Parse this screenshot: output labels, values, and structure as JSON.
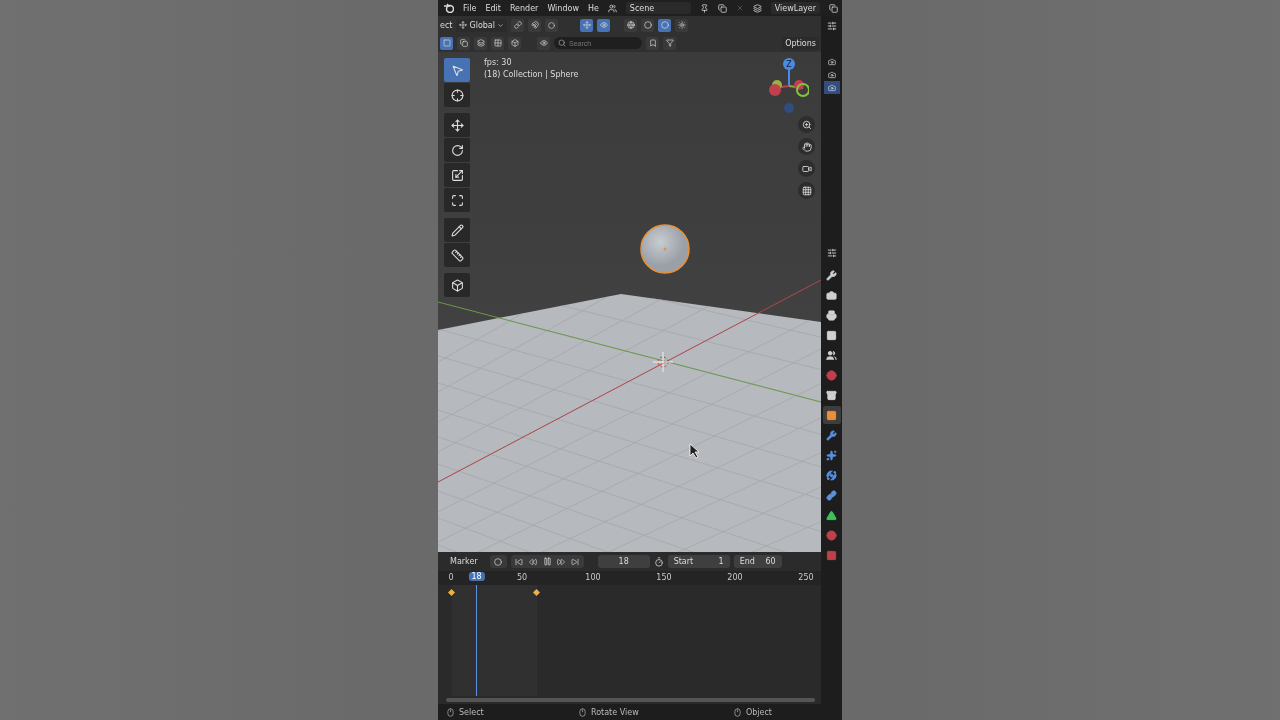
{
  "menu_bar": {
    "items": [
      "File",
      "Edit",
      "Render",
      "Window",
      "He"
    ],
    "scene": "Scene",
    "view_layer": "ViewLayer"
  },
  "header": {
    "mode_label": "ect",
    "orientation": "Global",
    "view_toggles": [
      {
        "kind": "gizmo",
        "on": true
      },
      {
        "kind": "overlay",
        "on": true
      }
    ],
    "shading_modes": [
      {
        "kind": "wireframe",
        "selected": false
      },
      {
        "kind": "solid",
        "selected": false
      },
      {
        "kind": "material",
        "selected": true
      },
      {
        "kind": "rendered",
        "selected": false
      }
    ],
    "select_modes": [
      {
        "kind": "new",
        "selected": true
      },
      {
        "kind": "extend",
        "selected": false
      },
      {
        "kind": "subtract",
        "selected": false
      },
      {
        "kind": "invert",
        "selected": false
      },
      {
        "kind": "intersect",
        "selected": false
      }
    ],
    "search": {
      "placeholder": "Search"
    },
    "options": "Options"
  },
  "toolbar": {
    "groups": [
      [
        {
          "kind": "select",
          "selected": true
        },
        {
          "kind": "cursor",
          "selected": false
        }
      ],
      [
        {
          "kind": "move",
          "selected": false
        },
        {
          "kind": "rotate",
          "selected": false
        },
        {
          "kind": "scale",
          "selected": false
        },
        {
          "kind": "transform",
          "selected": false
        }
      ],
      [
        {
          "kind": "annotate",
          "selected": false
        },
        {
          "kind": "measure",
          "selected": false
        }
      ],
      [
        {
          "kind": "add-cube",
          "selected": false
        }
      ]
    ]
  },
  "overlay": {
    "fps": "fps: 30",
    "info": "(18) Collection | Sphere"
  },
  "gizmo": {
    "z_label": "Z"
  },
  "outliner": {
    "items": [
      {
        "selected": false
      },
      {
        "selected": false
      },
      {
        "selected": true
      }
    ]
  },
  "properties_tabs": [
    {
      "kind": "tool",
      "selected": false,
      "color": "#d0d0d0"
    },
    {
      "kind": "render",
      "selected": false,
      "color": "#d0d0d0"
    },
    {
      "kind": "output",
      "selected": false,
      "color": "#d0d0d0"
    },
    {
      "kind": "view-layer",
      "selected": false,
      "color": "#d0d0d0"
    },
    {
      "kind": "scene",
      "selected": false,
      "color": "#d0d0d0"
    },
    {
      "kind": "world",
      "selected": false,
      "color": "#c0404a"
    },
    {
      "kind": "collection",
      "selected": false,
      "color": "#d0d0d0"
    },
    {
      "kind": "object",
      "selected": true,
      "color": "#e8903a"
    },
    {
      "kind": "modifier",
      "selected": false,
      "color": "#5a8fe0"
    },
    {
      "kind": "particles",
      "selected": false,
      "color": "#5a8fe0"
    },
    {
      "kind": "physics",
      "selected": false,
      "color": "#5a8fe0"
    },
    {
      "kind": "constraint",
      "selected": false,
      "color": "#5a8fe0"
    },
    {
      "kind": "data",
      "selected": false,
      "color": "#3fbf5a"
    },
    {
      "kind": "material",
      "selected": false,
      "color": "#c0404a"
    },
    {
      "kind": "texture",
      "selected": false,
      "color": "#c0404a"
    }
  ],
  "timeline": {
    "marker": "Marker",
    "current_frame": "18",
    "start_label": "Start",
    "start": "1",
    "end_label": "End",
    "end": "60",
    "ruler": [
      "0",
      "50",
      "100",
      "150",
      "200",
      "250"
    ],
    "playhead": "18",
    "playing": true
  },
  "status_bar": [
    "Select",
    "Rotate View",
    "Object"
  ]
}
